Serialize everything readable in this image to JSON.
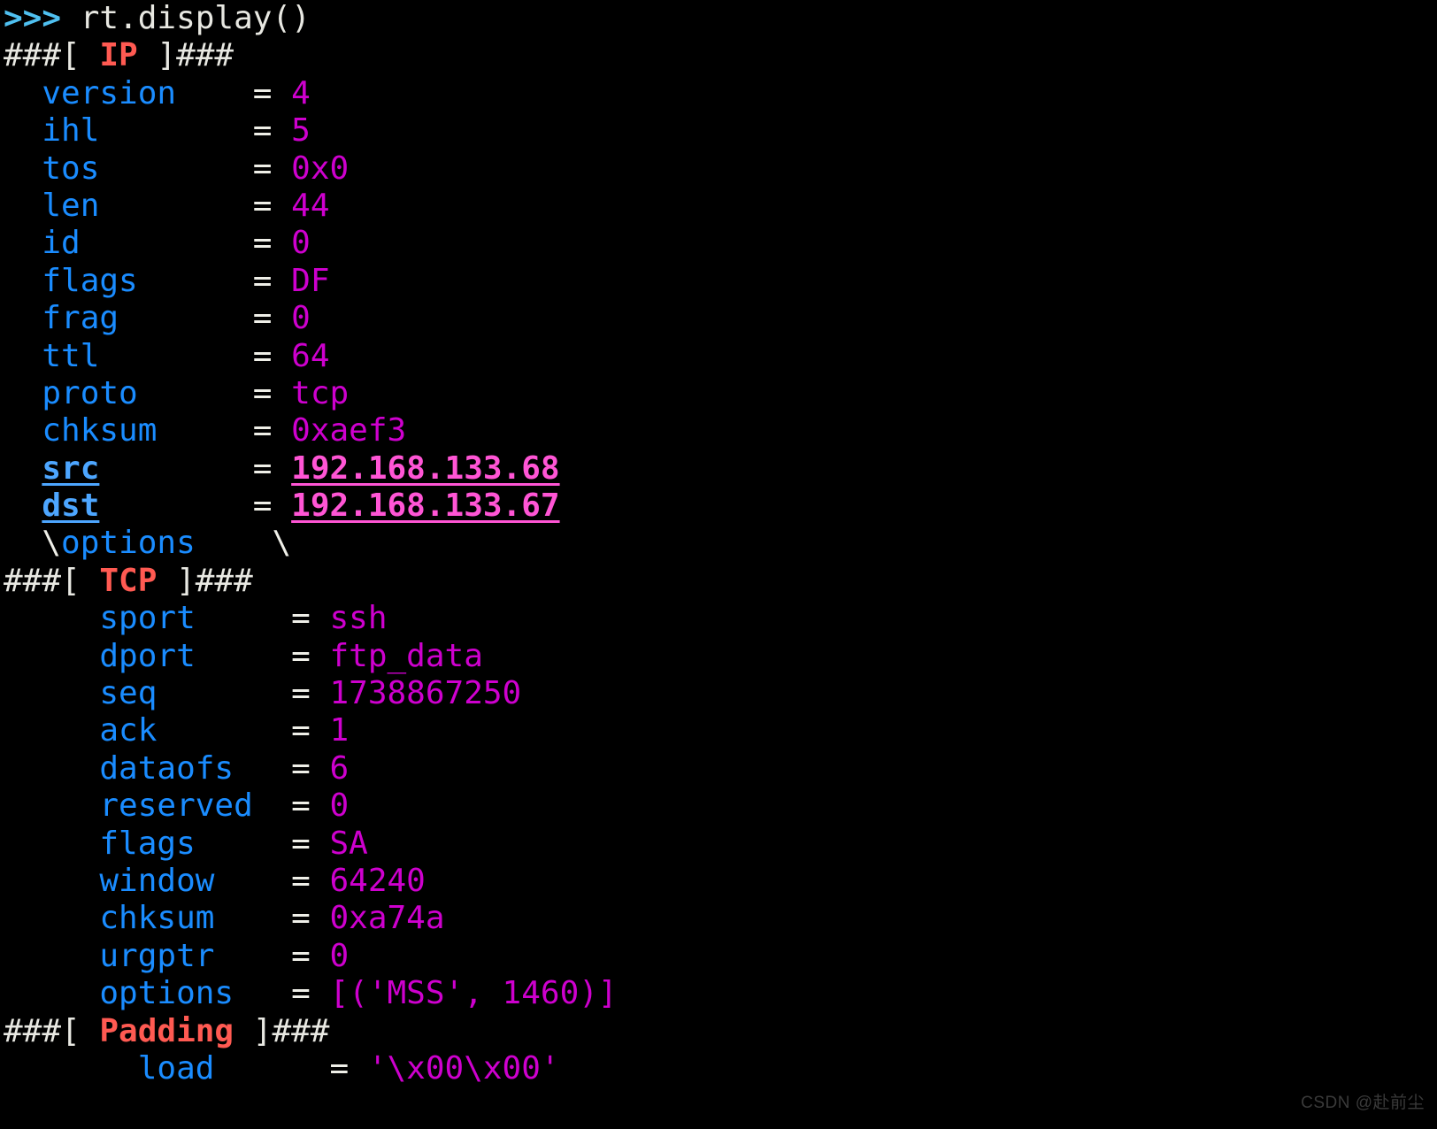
{
  "terminal": {
    "prompt_symbol": ">>>",
    "command": "rt.display()",
    "watermark": "CSDN @赴前尘",
    "colors": {
      "background": "#000000",
      "prompt": "#4FC0F0",
      "command_text": "#E8E8E2",
      "layer_header": "#FF5A52",
      "field_name": "#1A8CFF",
      "field_name_link": "#4DA6FF",
      "equals": "#EFEFE8",
      "value": "#CE00CE",
      "value_link": "#FF55D5",
      "watermark": "#3A3A3A"
    }
  },
  "layers": [
    {
      "name": "IP",
      "header_prefix": "###[ ",
      "header_suffix": " ]###",
      "indent": "  ",
      "name_width": 11,
      "fields": [
        {
          "name": "version",
          "eq": "=",
          "value": "4",
          "style": "normal"
        },
        {
          "name": "ihl",
          "eq": "=",
          "value": "5",
          "style": "normal"
        },
        {
          "name": "tos",
          "eq": "=",
          "value": "0x0",
          "style": "normal"
        },
        {
          "name": "len",
          "eq": "=",
          "value": "44",
          "style": "normal"
        },
        {
          "name": "id",
          "eq": "=",
          "value": "0",
          "style": "normal"
        },
        {
          "name": "flags",
          "eq": "=",
          "value": "DF",
          "style": "normal"
        },
        {
          "name": "frag",
          "eq": "=",
          "value": "0",
          "style": "normal"
        },
        {
          "name": "ttl",
          "eq": "=",
          "value": "64",
          "style": "normal"
        },
        {
          "name": "proto",
          "eq": "=",
          "value": "tcp",
          "style": "normal"
        },
        {
          "name": "chksum",
          "eq": "=",
          "value": "0xaef3",
          "style": "normal"
        },
        {
          "name": "src",
          "eq": "=",
          "value": "192.168.133.68",
          "style": "link"
        },
        {
          "name": "dst",
          "eq": "=",
          "value": "192.168.133.67",
          "style": "link"
        }
      ],
      "sublayer": {
        "prefix": "\\",
        "name": "options",
        "suffix": "\\"
      }
    },
    {
      "name": "TCP",
      "header_prefix": "###[ ",
      "header_suffix": " ]###",
      "indent": "     ",
      "name_width": 10,
      "fields": [
        {
          "name": "sport",
          "eq": "=",
          "value": "ssh",
          "style": "normal"
        },
        {
          "name": "dport",
          "eq": "=",
          "value": "ftp_data",
          "style": "normal"
        },
        {
          "name": "seq",
          "eq": "=",
          "value": "1738867250",
          "style": "normal"
        },
        {
          "name": "ack",
          "eq": "=",
          "value": "1",
          "style": "normal"
        },
        {
          "name": "dataofs",
          "eq": "=",
          "value": "6",
          "style": "normal"
        },
        {
          "name": "reserved",
          "eq": "=",
          "value": "0",
          "style": "normal"
        },
        {
          "name": "flags",
          "eq": "=",
          "value": "SA",
          "style": "normal"
        },
        {
          "name": "window",
          "eq": "=",
          "value": "64240",
          "style": "normal"
        },
        {
          "name": "chksum",
          "eq": "=",
          "value": "0xa74a",
          "style": "normal"
        },
        {
          "name": "urgptr",
          "eq": "=",
          "value": "0",
          "style": "normal"
        },
        {
          "name": "options",
          "eq": "=",
          "value": "[('MSS', 1460)]",
          "style": "normal"
        }
      ],
      "sublayer": null
    },
    {
      "name": "Padding",
      "header_prefix": "###[ ",
      "header_suffix": " ]###",
      "indent": "       ",
      "name_width": 10,
      "fields": [
        {
          "name": "load",
          "eq": "=",
          "value": "'\\x00\\x00'",
          "style": "normal"
        }
      ],
      "sublayer": null
    }
  ]
}
